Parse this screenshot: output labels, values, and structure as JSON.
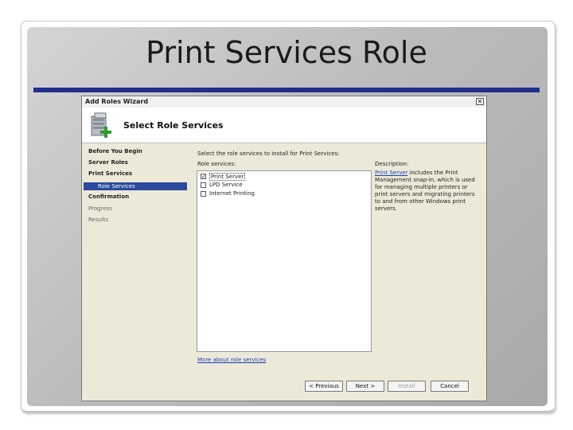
{
  "slide": {
    "title": "Print Services Role"
  },
  "wizard": {
    "window_title": "Add Roles Wizard",
    "close_glyph": "✕",
    "header_title": "Select Role Services",
    "nav": {
      "items": [
        {
          "label": "Before You Begin"
        },
        {
          "label": "Server Roles"
        },
        {
          "label": "Print Services"
        },
        {
          "label": "Role Services"
        },
        {
          "label": "Confirmation"
        },
        {
          "label": "Progress"
        },
        {
          "label": "Results"
        }
      ]
    },
    "instruction": "Select the role services to install for Print Services:",
    "role_services_label": "Role services:",
    "role_services": [
      {
        "label": "Print Server",
        "checked": true,
        "mark": "✓"
      },
      {
        "label": "LPD Service",
        "checked": false,
        "mark": ""
      },
      {
        "label": "Internet Printing",
        "checked": false,
        "mark": ""
      }
    ],
    "description_label": "Description:",
    "description_link": "Print Server",
    "description_text": " includes the Print Management snap-in, which is used for managing multiple printers or print servers and migrating printers to and from other Windows print servers.",
    "more_link": "More about role services",
    "buttons": {
      "previous": "< Previous",
      "next": "Next >",
      "install": "Install",
      "cancel": "Cancel"
    }
  }
}
